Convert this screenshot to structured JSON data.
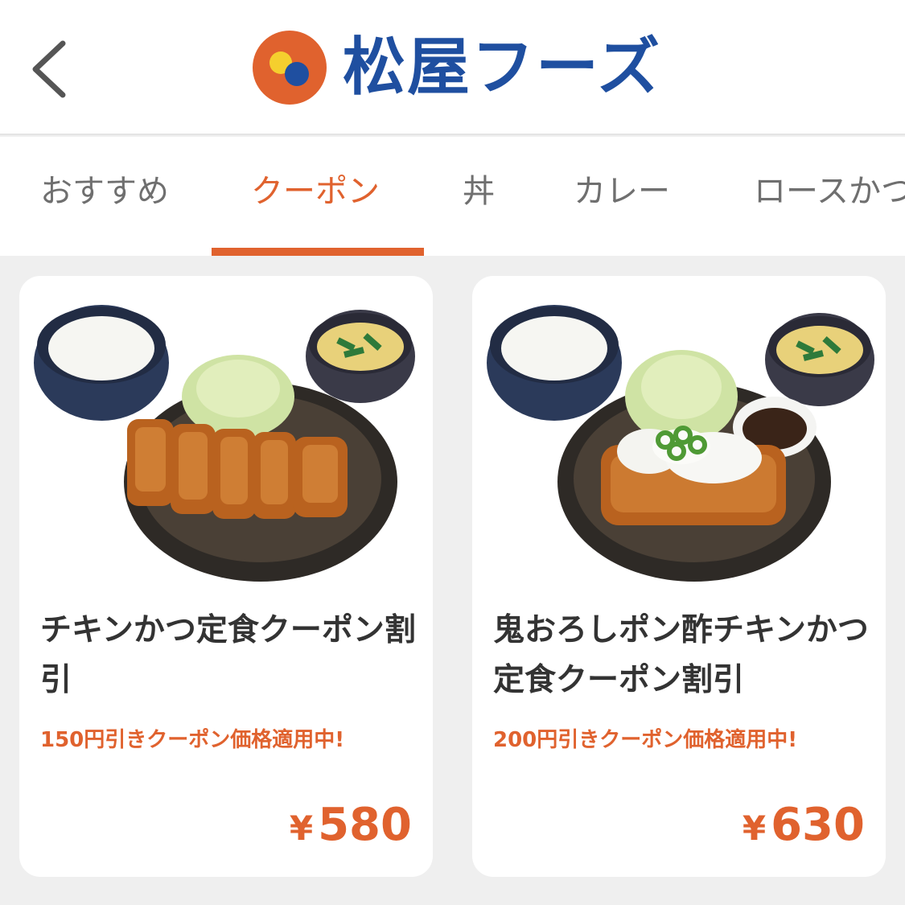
{
  "header": {
    "logo_text": "松屋フーズ"
  },
  "tabs": [
    {
      "label": "おすすめ",
      "active": false
    },
    {
      "label": "クーポン",
      "active": true
    },
    {
      "label": "丼",
      "active": false
    },
    {
      "label": "カレー",
      "active": false
    },
    {
      "label": "ロースかつ",
      "active": false
    }
  ],
  "products": [
    {
      "title": "チキンかつ定食クーポン割引",
      "promo": "150円引きクーポン価格適用中!",
      "currency": "¥",
      "price": "580",
      "image": "chicken-katsu-set-meal"
    },
    {
      "title": "鬼おろしポン酢チキンかつ定食クーポン割引",
      "promo": "200円引きクーポン価格適用中!",
      "currency": "¥",
      "price": "630",
      "image": "oroshi-ponzu-chicken-katsu-set-meal"
    }
  ],
  "colors": {
    "accent": "#e0622e",
    "brand_blue": "#1f4fa0",
    "background": "#efefef"
  }
}
